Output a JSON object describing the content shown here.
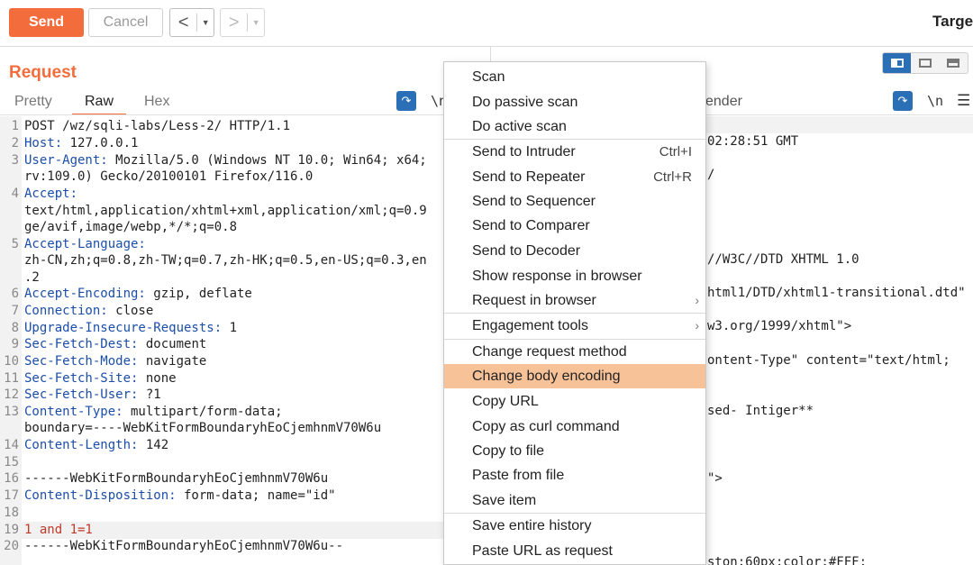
{
  "toolbar": {
    "send": "Send",
    "cancel": "Cancel",
    "back": "<",
    "forward": ">",
    "dropdown": "▼",
    "target": "Targe"
  },
  "request": {
    "title": "Request",
    "tabs": [
      "Pretty",
      "Raw",
      "Hex"
    ],
    "active_tab": "Raw",
    "newline_toggle": "\\n",
    "lines": [
      {
        "n": "1",
        "key": "",
        "text": "POST /wz/sqli-labs/Less-2/ HTTP/1.1"
      },
      {
        "n": "2",
        "key": "Host:",
        "text": " 127.0.0.1"
      },
      {
        "n": "3",
        "key": "User-Agent:",
        "text": " Mozilla/5.0 (Windows NT 10.0; Win64; x64;"
      },
      {
        "n": "",
        "key": "",
        "text": "rv:109.0) Gecko/20100101 Firefox/116.0"
      },
      {
        "n": "4",
        "key": "Accept:",
        "text": ""
      },
      {
        "n": "",
        "key": "",
        "text": "text/html,application/xhtml+xml,application/xml;q=0.9"
      },
      {
        "n": "",
        "key": "",
        "text": "ge/avif,image/webp,*/*;q=0.8"
      },
      {
        "n": "5",
        "key": "Accept-Language:",
        "text": ""
      },
      {
        "n": "",
        "key": "",
        "text": "zh-CN,zh;q=0.8,zh-TW;q=0.7,zh-HK;q=0.5,en-US;q=0.3,en"
      },
      {
        "n": "",
        "key": "",
        "text": ".2"
      },
      {
        "n": "6",
        "key": "Accept-Encoding:",
        "text": " gzip, deflate"
      },
      {
        "n": "7",
        "key": "Connection:",
        "text": " close"
      },
      {
        "n": "8",
        "key": "Upgrade-Insecure-Requests:",
        "text": " 1"
      },
      {
        "n": "9",
        "key": "Sec-Fetch-Dest:",
        "text": " document"
      },
      {
        "n": "10",
        "key": "Sec-Fetch-Mode:",
        "text": " navigate"
      },
      {
        "n": "11",
        "key": "Sec-Fetch-Site:",
        "text": " none"
      },
      {
        "n": "12",
        "key": "Sec-Fetch-User:",
        "text": " ?1"
      },
      {
        "n": "13",
        "key": "Content-Type:",
        "text": " multipart/form-data;"
      },
      {
        "n": "",
        "key": "",
        "text": "boundary=----WebKitFormBoundaryhEoCjemhnmV70W6u"
      },
      {
        "n": "14",
        "key": "Content-Length:",
        "text": " 142"
      },
      {
        "n": "15",
        "key": "",
        "text": ""
      },
      {
        "n": "16",
        "key": "",
        "text": "------WebKitFormBoundaryhEoCjemhnmV70W6u"
      },
      {
        "n": "17",
        "key": "Content-Disposition:",
        "text": " form-data; name=\"id\""
      },
      {
        "n": "18",
        "key": "",
        "text": ""
      },
      {
        "n": "19",
        "key": "",
        "text": "1 and 1=1"
      },
      {
        "n": "20",
        "key": "",
        "text": "------WebKitFormBoundaryhEoCjemhnmV70W6u--"
      }
    ]
  },
  "response": {
    "render_tab": "ender",
    "newline_toggle": "\\n",
    "menu": "☰",
    "fragments": [
      "02:28:51 GMT",
      "/",
      "//W3C//DTD XHTML 1.0",
      "html1/DTD/xhtml1-transitional.dtd\"",
      "w3.org/1999/xhtml\">",
      "ontent-Type\" content=\"text/html;",
      "sed- Intiger**",
      "\">",
      "ston:60px;color:#FFF;"
    ]
  },
  "context_menu": {
    "items": [
      {
        "label": "Scan",
        "shortcut": "",
        "submenu": false
      },
      {
        "label": "Do passive scan",
        "shortcut": "",
        "submenu": false
      },
      {
        "label": "Do active scan",
        "shortcut": "",
        "submenu": false
      },
      {
        "label": "Send to Intruder",
        "shortcut": "Ctrl+I",
        "submenu": false
      },
      {
        "label": "Send to Repeater",
        "shortcut": "Ctrl+R",
        "submenu": false
      },
      {
        "label": "Send to Sequencer",
        "shortcut": "",
        "submenu": false
      },
      {
        "label": "Send to Comparer",
        "shortcut": "",
        "submenu": false
      },
      {
        "label": "Send to Decoder",
        "shortcut": "",
        "submenu": false
      },
      {
        "label": "Show response in browser",
        "shortcut": "",
        "submenu": false
      },
      {
        "label": "Request in browser",
        "shortcut": "",
        "submenu": true
      },
      {
        "label": "Engagement tools",
        "shortcut": "",
        "submenu": true
      },
      {
        "label": "Change request method",
        "shortcut": "",
        "submenu": false
      },
      {
        "label": "Change body encoding",
        "shortcut": "",
        "submenu": false,
        "highlighted": true
      },
      {
        "label": "Copy URL",
        "shortcut": "",
        "submenu": false
      },
      {
        "label": "Copy as curl command",
        "shortcut": "",
        "submenu": false
      },
      {
        "label": "Copy to file",
        "shortcut": "",
        "submenu": false
      },
      {
        "label": "Paste from file",
        "shortcut": "",
        "submenu": false
      },
      {
        "label": "Save item",
        "shortcut": "",
        "submenu": false
      },
      {
        "label": "Save entire history",
        "shortcut": "",
        "submenu": false
      },
      {
        "label": "Paste URL as request",
        "shortcut": "",
        "submenu": false
      }
    ]
  },
  "colors": {
    "accent": "#f26c3c",
    "menu_highlight": "#f8c299",
    "header_key": "#1c4ea8",
    "body_text": "#c0392b",
    "toggle_active": "#2b6fb6"
  }
}
